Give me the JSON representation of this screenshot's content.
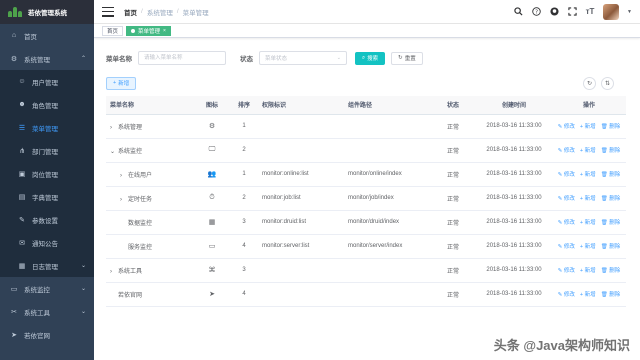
{
  "app": {
    "title": "若依管理系统"
  },
  "sidebar": {
    "items": [
      {
        "label": "首页",
        "icon": "dashboard-icon",
        "sub": false,
        "active": false,
        "arrow": ""
      },
      {
        "label": "系统管理",
        "icon": "gear-icon",
        "sub": false,
        "active": false,
        "arrow": "⌃"
      },
      {
        "label": "用户管理",
        "icon": "user-icon",
        "sub": true,
        "active": false,
        "arrow": ""
      },
      {
        "label": "角色管理",
        "icon": "peoples-icon",
        "sub": true,
        "active": false,
        "arrow": ""
      },
      {
        "label": "菜单管理",
        "icon": "tree-table-icon",
        "sub": true,
        "active": true,
        "arrow": ""
      },
      {
        "label": "部门管理",
        "icon": "tree-icon",
        "sub": true,
        "active": false,
        "arrow": ""
      },
      {
        "label": "岗位管理",
        "icon": "post-icon",
        "sub": true,
        "active": false,
        "arrow": ""
      },
      {
        "label": "字典管理",
        "icon": "dict-icon",
        "sub": true,
        "active": false,
        "arrow": ""
      },
      {
        "label": "参数设置",
        "icon": "edit-icon",
        "sub": true,
        "active": false,
        "arrow": ""
      },
      {
        "label": "通知公告",
        "icon": "message-icon",
        "sub": true,
        "active": false,
        "arrow": ""
      },
      {
        "label": "日志管理",
        "icon": "log-icon",
        "sub": true,
        "active": false,
        "arrow": "⌄"
      },
      {
        "label": "系统监控",
        "icon": "monitor-icon",
        "sub": false,
        "active": false,
        "arrow": "⌄"
      },
      {
        "label": "系统工具",
        "icon": "tool-icon",
        "sub": false,
        "active": false,
        "arrow": "⌄"
      },
      {
        "label": "若依官网",
        "icon": "guide-icon",
        "sub": false,
        "active": false,
        "arrow": ""
      }
    ]
  },
  "breadcrumb": [
    "首页",
    "系统管理",
    "菜单管理"
  ],
  "navbar_icons": [
    "search-icon",
    "question-icon",
    "github-icon",
    "fullscreen-icon",
    "font-size-icon"
  ],
  "tags": [
    {
      "label": "首页",
      "active": false
    },
    {
      "label": "菜单管理",
      "active": true
    }
  ],
  "search": {
    "name_label": "菜单名称",
    "name_placeholder": "请输入菜单名称",
    "status_label": "状态",
    "status_placeholder": "菜单状态",
    "search_btn": "搜索",
    "reset_btn": "重置"
  },
  "toolbar": {
    "add_btn": "新增"
  },
  "table": {
    "headers": [
      "菜单名称",
      "图标",
      "排序",
      "权限标识",
      "组件路径",
      "状态",
      "创建时间",
      "操作"
    ],
    "ops": {
      "edit": "修改",
      "add": "新增",
      "delete": "删除"
    },
    "rows": [
      {
        "name": "系统管理",
        "level": 0,
        "expander": "›",
        "icon": "⚙",
        "order": "1",
        "perm": "",
        "component": "",
        "status": "正常",
        "created": "2018-03-16 11:33:00"
      },
      {
        "name": "系统监控",
        "level": 0,
        "expander": "⌄",
        "icon": "🖵",
        "order": "2",
        "perm": "",
        "component": "",
        "status": "正常",
        "created": "2018-03-16 11:33:00"
      },
      {
        "name": "在线用户",
        "level": 1,
        "expander": "›",
        "icon": "👥",
        "order": "1",
        "perm": "monitor:online:list",
        "component": "monitor/online/index",
        "status": "正常",
        "created": "2018-03-16 11:33:00"
      },
      {
        "name": "定时任务",
        "level": 1,
        "expander": "›",
        "icon": "⏱",
        "order": "2",
        "perm": "monitor:job:list",
        "component": "monitor/job/index",
        "status": "正常",
        "created": "2018-03-16 11:33:00"
      },
      {
        "name": "数据监控",
        "level": 1,
        "expander": "",
        "icon": "▦",
        "order": "3",
        "perm": "monitor:druid:list",
        "component": "monitor/druid/index",
        "status": "正常",
        "created": "2018-03-16 11:33:00"
      },
      {
        "name": "服务监控",
        "level": 1,
        "expander": "",
        "icon": "▭",
        "order": "4",
        "perm": "monitor:server:list",
        "component": "monitor/server/index",
        "status": "正常",
        "created": "2018-03-16 11:33:00"
      },
      {
        "name": "系统工具",
        "level": 0,
        "expander": "›",
        "icon": "⌘",
        "order": "3",
        "perm": "",
        "component": "",
        "status": "正常",
        "created": "2018-03-16 11:33:00"
      },
      {
        "name": "若依官网",
        "level": 0,
        "expander": "",
        "icon": "➤",
        "order": "4",
        "perm": "",
        "component": "",
        "status": "正常",
        "created": "2018-03-16 11:33:00"
      }
    ]
  },
  "watermark": "头条 @Java架构师知识",
  "colors": {
    "sidebar_bg": "#304156",
    "active": "#409eff",
    "primary": "#13c2c2",
    "tag_active": "#42b983"
  }
}
